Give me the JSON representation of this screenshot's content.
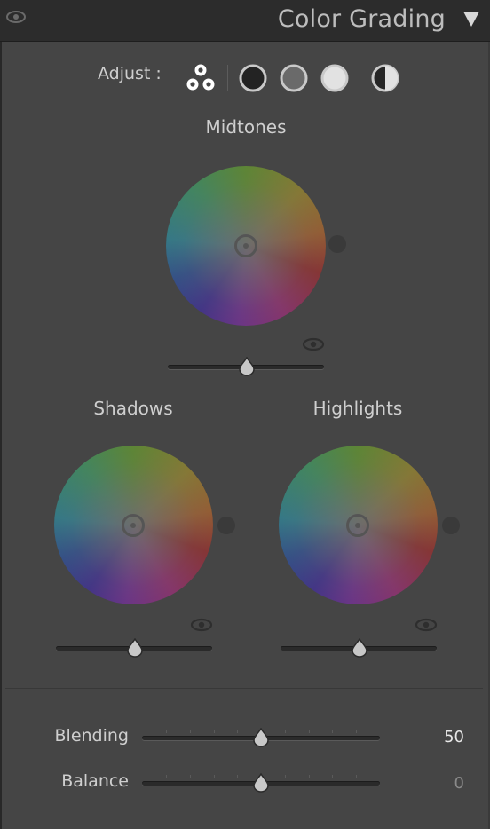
{
  "header": {
    "title": "Color Grading",
    "visibility_icon": "eye-icon",
    "collapse_icon": "triangle-down-icon"
  },
  "adjust": {
    "label": "Adjust :",
    "modes": [
      {
        "name": "three-way",
        "icon": "three-circles-icon",
        "selected": true
      },
      {
        "name": "shadows",
        "icon": "dark-circle-icon"
      },
      {
        "name": "midtones",
        "icon": "mid-circle-icon"
      },
      {
        "name": "highlights",
        "icon": "light-circle-icon"
      },
      {
        "name": "global",
        "icon": "half-circle-icon"
      }
    ]
  },
  "wheels": {
    "midtones": {
      "label": "Midtones",
      "luminance": 0
    },
    "shadows": {
      "label": "Shadows",
      "luminance": 0
    },
    "highlights": {
      "label": "Highlights",
      "luminance": 0
    }
  },
  "blending": {
    "label": "Blending",
    "value": "50"
  },
  "balance": {
    "label": "Balance",
    "value": "0"
  },
  "colors": {
    "background": "#454545",
    "header": "#2c2c2c",
    "text": "#cfcfcf",
    "value_active": "#e8e8e8",
    "value_muted": "#8a8a8a"
  }
}
